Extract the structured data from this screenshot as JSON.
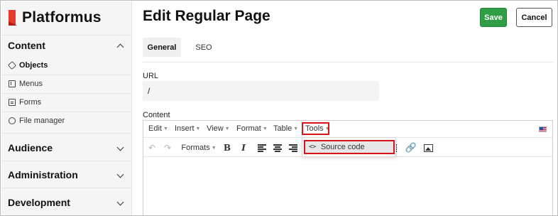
{
  "sidebar": {
    "brand": "Platformus",
    "sections": [
      {
        "title": "Content",
        "expanded": true,
        "items": [
          {
            "label": "Objects",
            "icon": "tag-icon",
            "active": true
          },
          {
            "label": "Menus",
            "icon": "menu-icon",
            "active": false
          },
          {
            "label": "Forms",
            "icon": "form-icon",
            "active": false
          },
          {
            "label": "File manager",
            "icon": "file-icon",
            "active": false
          }
        ]
      },
      {
        "title": "Audience",
        "expanded": false
      },
      {
        "title": "Administration",
        "expanded": false
      },
      {
        "title": "Development",
        "expanded": false
      }
    ]
  },
  "header": {
    "title": "Edit Regular Page",
    "save_label": "Save",
    "cancel_label": "Cancel"
  },
  "tabs": [
    {
      "label": "General",
      "active": true
    },
    {
      "label": "SEO",
      "active": false
    }
  ],
  "form": {
    "url_label": "URL",
    "url_value": "/",
    "content_label": "Content"
  },
  "editor": {
    "menubar": [
      "Edit",
      "Insert",
      "View",
      "Format",
      "Table",
      "Tools"
    ],
    "formats_label": "Formats",
    "tools_menu": [
      {
        "label": "Source code",
        "icon": "code-icon"
      }
    ],
    "language_flag": "us-flag-icon"
  },
  "colors": {
    "save_button": "#2f9e44",
    "highlight": "#d8141a",
    "brand_red": "#e8392e"
  }
}
